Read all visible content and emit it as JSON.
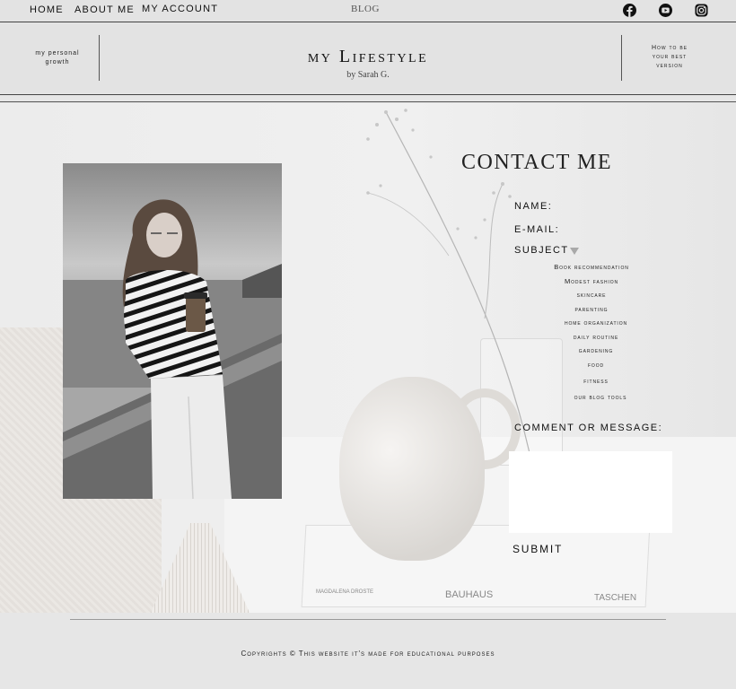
{
  "nav": {
    "links": [
      "HOME",
      "ABOUT ME",
      "MY ACCOUNT"
    ],
    "center": "BLOG",
    "social": [
      "facebook-icon",
      "youtube-icon",
      "instagram-icon"
    ]
  },
  "header": {
    "left_text_1": "my personal",
    "left_text_2": "growth",
    "title": "my Lifestyle",
    "subtitle": "by Sarah G.",
    "right_text_1": "How to be",
    "right_text_2": "your best",
    "right_text_3": "version"
  },
  "contact": {
    "title": "CONTACT ME",
    "name_label": "NAME:",
    "email_label": "E-MAIL:",
    "subject_label": "SUBJECT",
    "subject_options": [
      "Book recommendation",
      "Modest fashion",
      "skincare",
      "parenting",
      "home organization",
      "daily routine",
      "gardening",
      "food",
      "fitness",
      "our blog tools"
    ],
    "comment_label": "COMMENT OR MESSAGE:",
    "submit_label": "SUBMIT"
  },
  "decor": {
    "book_author": "MAGDALENA DROSTE",
    "book_title": "BAUHAUS",
    "book_publisher": "TASCHEN"
  },
  "footer": {
    "text": "Copyrights © This website it's made for educational purposes"
  },
  "colors": {
    "background": "#e6e6e6",
    "ink": "#111111",
    "rule": "#444444"
  }
}
